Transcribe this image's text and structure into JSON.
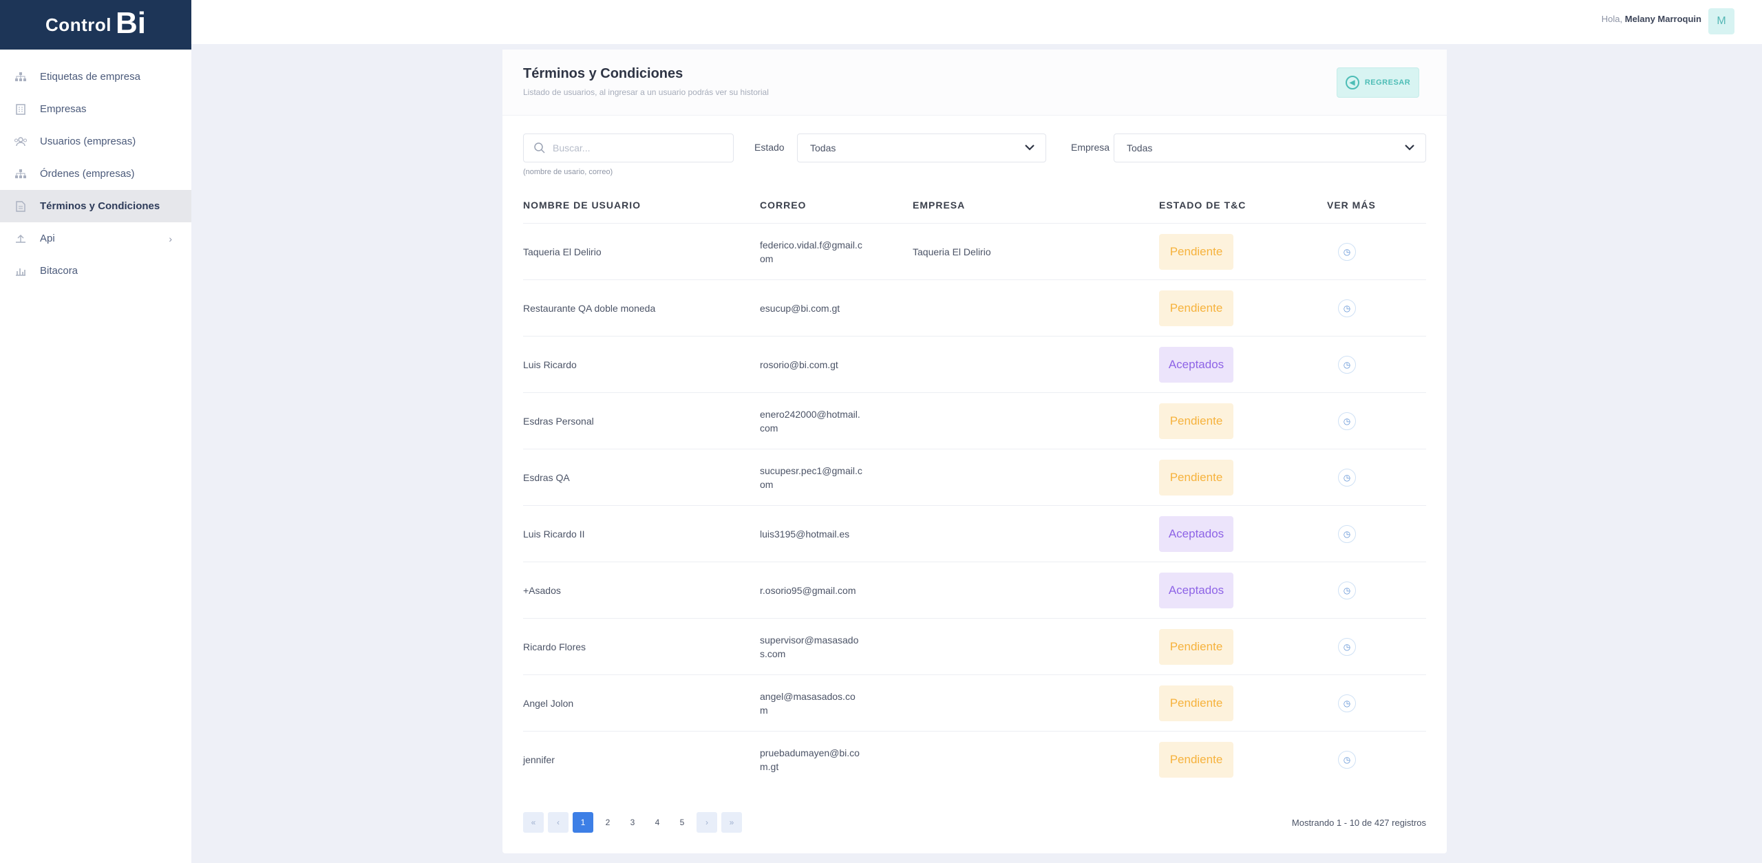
{
  "brand": {
    "part1": "Control",
    "part2": "Bi"
  },
  "sidebar": {
    "items": [
      {
        "label": "Etiquetas de empresa",
        "icon": "hierarchy-icon"
      },
      {
        "label": "Empresas",
        "icon": "building-icon"
      },
      {
        "label": "Usuarios (empresas)",
        "icon": "users-icon"
      },
      {
        "label": "Órdenes (empresas)",
        "icon": "hierarchy-icon"
      },
      {
        "label": "Términos y Condiciones",
        "icon": "document-icon",
        "active": true
      },
      {
        "label": "Api",
        "icon": "api-icon",
        "has_children": true
      },
      {
        "label": "Bitacora",
        "icon": "chart-icon"
      }
    ]
  },
  "header": {
    "greeting": "Hola,",
    "user_name": "Melany Marroquin",
    "avatar_initial": "M"
  },
  "page": {
    "title": "Términos y Condiciones",
    "subtitle": "Listado de usuarios, al ingresar a un usuario podrás ver su historial",
    "back_label": "REGRESAR"
  },
  "filters": {
    "search_placeholder": "Buscar...",
    "search_hint": "(nombre de usario, correo)",
    "estado_label": "Estado",
    "estado_value": "Todas",
    "empresa_label": "Empresa",
    "empresa_value": "Todas"
  },
  "table": {
    "columns": [
      "NOMBRE DE USUARIO",
      "CORREO",
      "EMPRESA",
      "ESTADO DE T&C",
      "VER MÁS"
    ],
    "rows": [
      {
        "name": "Taqueria El Delirio",
        "email": "federico.vidal.f@gmail.com",
        "company": "Taqueria El Delirio",
        "status": "Pendiente"
      },
      {
        "name": "Restaurante QA doble moneda",
        "email": "esucup@bi.com.gt",
        "company": "",
        "status": "Pendiente"
      },
      {
        "name": "Luis Ricardo",
        "email": "rosorio@bi.com.gt",
        "company": "",
        "status": "Aceptados"
      },
      {
        "name": "Esdras Personal",
        "email": "enero242000@hotmail.com",
        "company": "",
        "status": "Pendiente"
      },
      {
        "name": "Esdras QA",
        "email": "sucupesr.pec1@gmail.com",
        "company": "",
        "status": "Pendiente"
      },
      {
        "name": "Luis Ricardo II",
        "email": "luis3195@hotmail.es",
        "company": "",
        "status": "Aceptados"
      },
      {
        "name": "+Asados",
        "email": "r.osorio95@gmail.com",
        "company": "",
        "status": "Aceptados"
      },
      {
        "name": "Ricardo Flores",
        "email": "supervisor@masasados.com",
        "company": "",
        "status": "Pendiente"
      },
      {
        "name": "Angel Jolon",
        "email": "angel@masasados.com",
        "company": "",
        "status": "Pendiente"
      },
      {
        "name": "jennifer",
        "email": "pruebadumayen@bi.com.gt",
        "company": "",
        "status": "Pendiente"
      }
    ]
  },
  "pagination": {
    "first": "«",
    "prev": "‹",
    "next": "›",
    "last": "»",
    "pages": [
      "1",
      "2",
      "3",
      "4",
      "5"
    ],
    "current": "1",
    "summary": "Mostrando 1 - 10 de 427 registros"
  },
  "colors": {
    "brand_dark": "#1d3557",
    "pending": "#f6b23c",
    "accepted": "#8e64e6",
    "accent": "#3d7fe6",
    "back_button": "#4dbdb6"
  }
}
